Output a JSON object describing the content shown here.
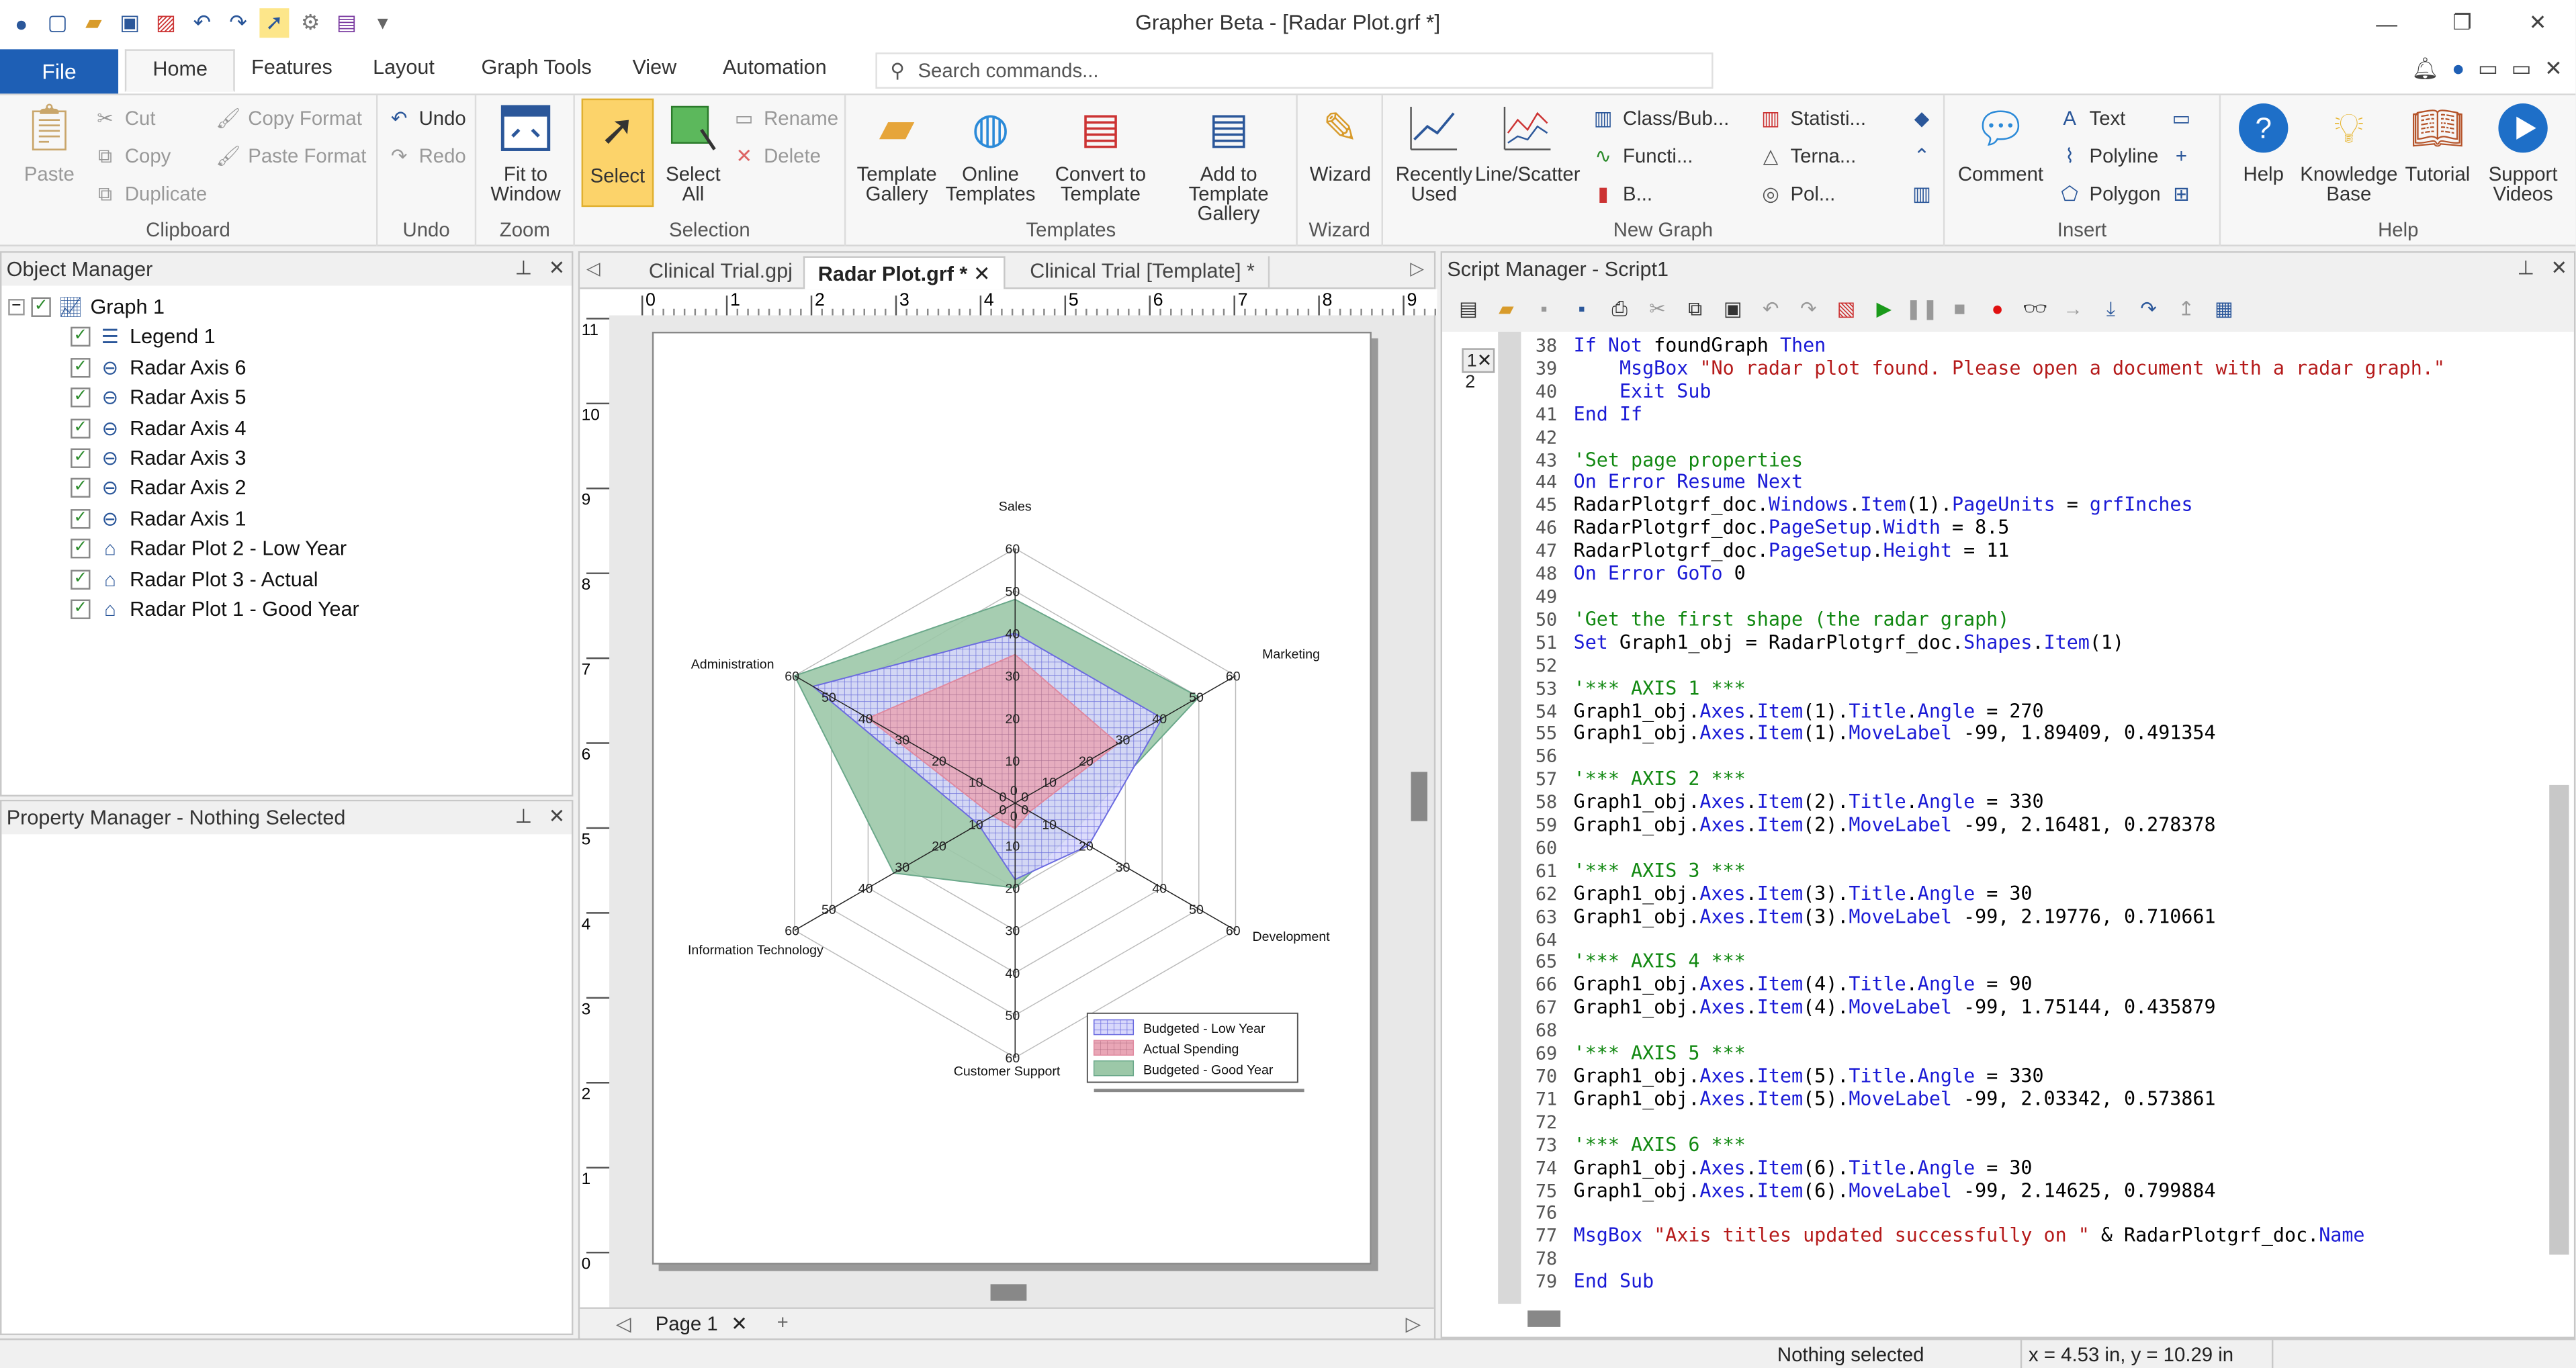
{
  "app": {
    "title": "Grapher Beta - [Radar Plot.grf *]"
  },
  "tabs": {
    "file": "File",
    "items": [
      "Home",
      "Features",
      "Layout",
      "Graph Tools",
      "View",
      "Automation"
    ],
    "search_placeholder": "Search commands..."
  },
  "ribbon": {
    "clipboard": {
      "label": "Clipboard",
      "paste": "Paste",
      "cut": "Cut",
      "copy": "Copy",
      "duplicate": "Duplicate",
      "copy_format": "Copy Format",
      "paste_format": "Paste Format"
    },
    "undo": {
      "label": "Undo",
      "undo": "Undo",
      "redo": "Redo"
    },
    "zoom": {
      "label": "Zoom",
      "fit": "Fit to",
      "fit2": "Window"
    },
    "selection": {
      "label": "Selection",
      "select": "Select",
      "select_all": "Select",
      "select_all2": "All",
      "rename": "Rename",
      "delete": "Delete"
    },
    "templates": {
      "label": "Templates",
      "gallery": "Template",
      "gallery2": "Gallery",
      "online": "Online",
      "online2": "Templates",
      "convert": "Convert to",
      "convert2": "Template",
      "add": "Add to",
      "add2": "Template Gallery"
    },
    "wizard": {
      "label": "Wizard",
      "wizard": "Wizard"
    },
    "newgraph": {
      "label": "New Graph",
      "recent": "Recently",
      "recent2": "Used",
      "line": "Line/Scatter",
      "class": "Class/Bub...",
      "func": "Functi...",
      "b": "B...",
      "stat": "Statisti...",
      "tern": "Terna...",
      "pol": "Pol..."
    },
    "insert": {
      "label": "Insert",
      "comment": "Comment",
      "text": "Text",
      "polyline": "Polyline",
      "polygon": "Polygon"
    },
    "help": {
      "label": "Help",
      "help": "Help",
      "kb": "Knowledge",
      "kb2": "Base",
      "tutorial": "Tutorial",
      "support": "Support",
      "support2": "Videos"
    }
  },
  "object_manager": {
    "title": "Object Manager",
    "items": [
      "Graph 1",
      "Legend 1",
      "Radar Axis 6",
      "Radar Axis 5",
      "Radar Axis 4",
      "Radar Axis 3",
      "Radar Axis 2",
      "Radar Axis 1",
      "Radar Plot 2 - Low Year",
      "Radar Plot 3 - Actual",
      "Radar Plot 1 - Good Year"
    ]
  },
  "property_manager": {
    "title": "Property Manager - Nothing Selected"
  },
  "doc_tabs": [
    "Clinical Trial.gpj",
    "Radar Plot.grf *",
    "Clinical Trial [Template] *"
  ],
  "ruler": {
    "h": [
      "0",
      "1",
      "2",
      "3",
      "4",
      "5",
      "6",
      "7",
      "8",
      "9"
    ],
    "v": [
      "11",
      "10",
      "9",
      "8",
      "7",
      "6",
      "5",
      "4",
      "3",
      "2",
      "1",
      "0"
    ]
  },
  "page_tab": "Page 1",
  "chart_data": {
    "type": "radar",
    "axes": [
      "Sales",
      "Marketing",
      "Development",
      "Customer Support",
      "Information Technology",
      "Administration"
    ],
    "ticks": [
      "0",
      "10",
      "20",
      "30",
      "40",
      "50",
      "60"
    ],
    "rlim": [
      0,
      60
    ],
    "series": [
      {
        "name": "Budgeted - Low Year",
        "values": [
          40,
          40,
          20,
          18,
          10,
          55
        ],
        "color": "#6a6ae0"
      },
      {
        "name": "Actual Spending",
        "values": [
          35,
          28,
          4,
          6,
          6,
          40
        ],
        "color": "#e08aa0"
      },
      {
        "name": "Budgeted - Good Year",
        "values": [
          48,
          50,
          15,
          20,
          33,
          60
        ],
        "color": "#6aa88a"
      }
    ],
    "legend": "bottom-right"
  },
  "script_manager": {
    "title": "Script Manager - Script1",
    "tab_markers": [
      "1",
      "2"
    ],
    "lines": [
      {
        "n": "38",
        "html": "<span class=\"kw\">If Not</span> foundGraph <span class=\"kw\">Then</span>"
      },
      {
        "n": "39",
        "html": "    <span class=\"kw\">MsgBox</span> <span class=\"str\">\"No radar plot found. Please open a document with a radar graph.\"</span>"
      },
      {
        "n": "40",
        "html": "    <span class=\"kw\">Exit Sub</span>"
      },
      {
        "n": "41",
        "html": "<span class=\"kw\">End If</span>"
      },
      {
        "n": "42",
        "html": ""
      },
      {
        "n": "43",
        "html": "<span class=\"cm\">'Set page properties</span>"
      },
      {
        "n": "44",
        "html": "<span class=\"kw\">On Error Resume Next</span>"
      },
      {
        "n": "45",
        "html": "RadarPlotgrf_doc.<span class=\"kw\">Windows</span>.<span class=\"kw\">Item</span>(1).<span class=\"kw\">PageUnits</span> = <span class=\"kw\">grfInches</span>"
      },
      {
        "n": "46",
        "html": "RadarPlotgrf_doc.<span class=\"kw\">PageSetup</span>.<span class=\"kw\">Width</span> = 8.5"
      },
      {
        "n": "47",
        "html": "RadarPlotgrf_doc.<span class=\"kw\">PageSetup</span>.<span class=\"kw\">Height</span> = 11"
      },
      {
        "n": "48",
        "html": "<span class=\"kw\">On Error GoTo</span> 0"
      },
      {
        "n": "49",
        "html": ""
      },
      {
        "n": "50",
        "html": "<span class=\"cm\">'Get the first shape (the radar graph)</span>"
      },
      {
        "n": "51",
        "html": "<span class=\"kw\">Set</span> Graph1_obj = RadarPlotgrf_doc.<span class=\"kw\">Shapes</span>.<span class=\"kw\">Item</span>(1)"
      },
      {
        "n": "52",
        "html": ""
      },
      {
        "n": "53",
        "html": "<span class=\"cm\">'*** AXIS 1 ***</span>"
      },
      {
        "n": "54",
        "html": "Graph1_obj.<span class=\"kw\">Axes</span>.<span class=\"kw\">Item</span>(1).<span class=\"kw\">Title</span>.<span class=\"kw\">Angle</span> = 270"
      },
      {
        "n": "55",
        "html": "Graph1_obj.<span class=\"kw\">Axes</span>.<span class=\"kw\">Item</span>(1).<span class=\"kw\">MoveLabel</span> -99, 1.89409, 0.491354"
      },
      {
        "n": "56",
        "html": ""
      },
      {
        "n": "57",
        "html": "<span class=\"cm\">'*** AXIS 2 ***</span>"
      },
      {
        "n": "58",
        "html": "Graph1_obj.<span class=\"kw\">Axes</span>.<span class=\"kw\">Item</span>(2).<span class=\"kw\">Title</span>.<span class=\"kw\">Angle</span> = 330"
      },
      {
        "n": "59",
        "html": "Graph1_obj.<span class=\"kw\">Axes</span>.<span class=\"kw\">Item</span>(2).<span class=\"kw\">MoveLabel</span> -99, 2.16481, 0.278378"
      },
      {
        "n": "60",
        "html": ""
      },
      {
        "n": "61",
        "html": "<span class=\"cm\">'*** AXIS 3 ***</span>"
      },
      {
        "n": "62",
        "html": "Graph1_obj.<span class=\"kw\">Axes</span>.<span class=\"kw\">Item</span>(3).<span class=\"kw\">Title</span>.<span class=\"kw\">Angle</span> = 30"
      },
      {
        "n": "63",
        "html": "Graph1_obj.<span class=\"kw\">Axes</span>.<span class=\"kw\">Item</span>(3).<span class=\"kw\">MoveLabel</span> -99, 2.19776, 0.710661"
      },
      {
        "n": "64",
        "html": ""
      },
      {
        "n": "65",
        "html": "<span class=\"cm\">'*** AXIS 4 ***</span>"
      },
      {
        "n": "66",
        "html": "Graph1_obj.<span class=\"kw\">Axes</span>.<span class=\"kw\">Item</span>(4).<span class=\"kw\">Title</span>.<span class=\"kw\">Angle</span> = 90"
      },
      {
        "n": "67",
        "html": "Graph1_obj.<span class=\"kw\">Axes</span>.<span class=\"kw\">Item</span>(4).<span class=\"kw\">MoveLabel</span> -99, 1.75144, 0.435879"
      },
      {
        "n": "68",
        "html": ""
      },
      {
        "n": "69",
        "html": "<span class=\"cm\">'*** AXIS 5 ***</span>"
      },
      {
        "n": "70",
        "html": "Graph1_obj.<span class=\"kw\">Axes</span>.<span class=\"kw\">Item</span>(5).<span class=\"kw\">Title</span>.<span class=\"kw\">Angle</span> = 330"
      },
      {
        "n": "71",
        "html": "Graph1_obj.<span class=\"kw\">Axes</span>.<span class=\"kw\">Item</span>(5).<span class=\"kw\">MoveLabel</span> -99, 2.03342, 0.573861"
      },
      {
        "n": "72",
        "html": ""
      },
      {
        "n": "73",
        "html": "<span class=\"cm\">'*** AXIS 6 ***</span>"
      },
      {
        "n": "74",
        "html": "Graph1_obj.<span class=\"kw\">Axes</span>.<span class=\"kw\">Item</span>(6).<span class=\"kw\">Title</span>.<span class=\"kw\">Angle</span> = 30"
      },
      {
        "n": "75",
        "html": "Graph1_obj.<span class=\"kw\">Axes</span>.<span class=\"kw\">Item</span>(6).<span class=\"kw\">MoveLabel</span> -99, 2.14625, 0.799884"
      },
      {
        "n": "76",
        "html": ""
      },
      {
        "n": "77",
        "html": "<span class=\"kw\">MsgBox</span> <span class=\"str\">\"Axis titles updated successfully on \"</span> &amp; RadarPlotgrf_doc.<span class=\"kw\">Name</span>"
      },
      {
        "n": "78",
        "html": ""
      },
      {
        "n": "79",
        "html": "<span class=\"kw\">End Sub</span>"
      }
    ]
  },
  "status": {
    "selection": "Nothing selected",
    "coords": "x = 4.53 in, y = 10.29 in"
  }
}
